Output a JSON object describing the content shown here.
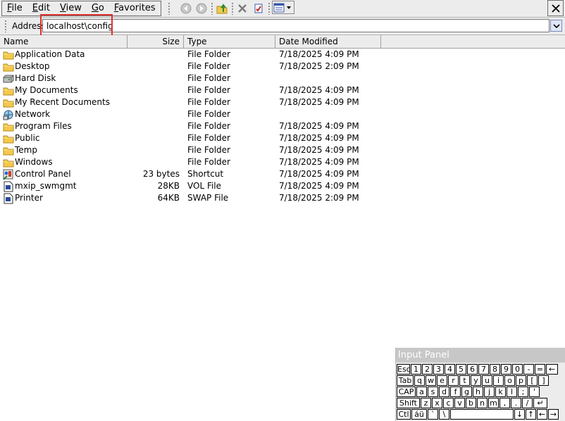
{
  "menu": {
    "items": [
      "File",
      "Edit",
      "View",
      "Go",
      "Favorites"
    ]
  },
  "toolbar": {
    "icons": [
      "back-icon",
      "forward-icon",
      "up-folder-icon",
      "delete-icon",
      "properties-icon",
      "views-icon"
    ]
  },
  "address": {
    "label": "Address",
    "value": "localhost\\config"
  },
  "columns": [
    "Name",
    "Size",
    "Type",
    "Date Modified"
  ],
  "files": [
    {
      "name": "Application Data",
      "size": "",
      "type": "File Folder",
      "date": "7/18/2025 4:09 PM",
      "icon": "folder-icon"
    },
    {
      "name": "Desktop",
      "size": "",
      "type": "File Folder",
      "date": "7/18/2025 2:09 PM",
      "icon": "folder-icon"
    },
    {
      "name": "Hard Disk",
      "size": "",
      "type": "File Folder",
      "date": "",
      "icon": "hard-disk-icon"
    },
    {
      "name": "My Documents",
      "size": "",
      "type": "File Folder",
      "date": "7/18/2025 4:09 PM",
      "icon": "folder-icon"
    },
    {
      "name": "My Recent Documents",
      "size": "",
      "type": "File Folder",
      "date": "7/18/2025 4:09 PM",
      "icon": "folder-icon"
    },
    {
      "name": "Network",
      "size": "",
      "type": "File Folder",
      "date": "",
      "icon": "network-icon"
    },
    {
      "name": "Program Files",
      "size": "",
      "type": "File Folder",
      "date": "7/18/2025 4:09 PM",
      "icon": "folder-icon"
    },
    {
      "name": "Public",
      "size": "",
      "type": "File Folder",
      "date": "7/18/2025 4:09 PM",
      "icon": "folder-icon"
    },
    {
      "name": "Temp",
      "size": "",
      "type": "File Folder",
      "date": "7/18/2025 4:09 PM",
      "icon": "folder-icon"
    },
    {
      "name": "Windows",
      "size": "",
      "type": "File Folder",
      "date": "7/18/2025 4:09 PM",
      "icon": "folder-icon"
    },
    {
      "name": "Control Panel",
      "size": "23 bytes",
      "type": "Shortcut",
      "date": "7/18/2025 4:09 PM",
      "icon": "control-panel-icon"
    },
    {
      "name": "mxip_swmgmt",
      "size": "28KB",
      "type": "VOL File",
      "date": "7/18/2025 4:09 PM",
      "icon": "file-icon"
    },
    {
      "name": "Printer",
      "size": "64KB",
      "type": "SWAP File",
      "date": "7/18/2025 2:09 PM",
      "icon": "file-icon"
    }
  ],
  "input_panel": {
    "title": "Input Panel",
    "rows": [
      [
        "Esc",
        "1",
        "2",
        "3",
        "4",
        "5",
        "6",
        "7",
        "8",
        "9",
        "0",
        "-",
        "=",
        "←"
      ],
      [
        "Tab",
        "q",
        "w",
        "e",
        "r",
        "t",
        "y",
        "u",
        "i",
        "o",
        "p",
        "[",
        "]"
      ],
      [
        "CAP",
        "a",
        "s",
        "d",
        "f",
        "g",
        "h",
        "j",
        "k",
        "l",
        ";",
        "'"
      ],
      [
        "Shift",
        "z",
        "x",
        "c",
        "v",
        "b",
        "n",
        "m",
        ",",
        ".",
        "/",
        "↵"
      ],
      [
        "Ctl",
        "áü",
        "`",
        "\\",
        "",
        "↓",
        "↑",
        "←",
        "→"
      ]
    ]
  },
  "colors": {
    "chrome": "#ececec",
    "highlight_box": "#e03030",
    "panel_title": "#c7c7c7",
    "folder": "#f2c94c"
  }
}
